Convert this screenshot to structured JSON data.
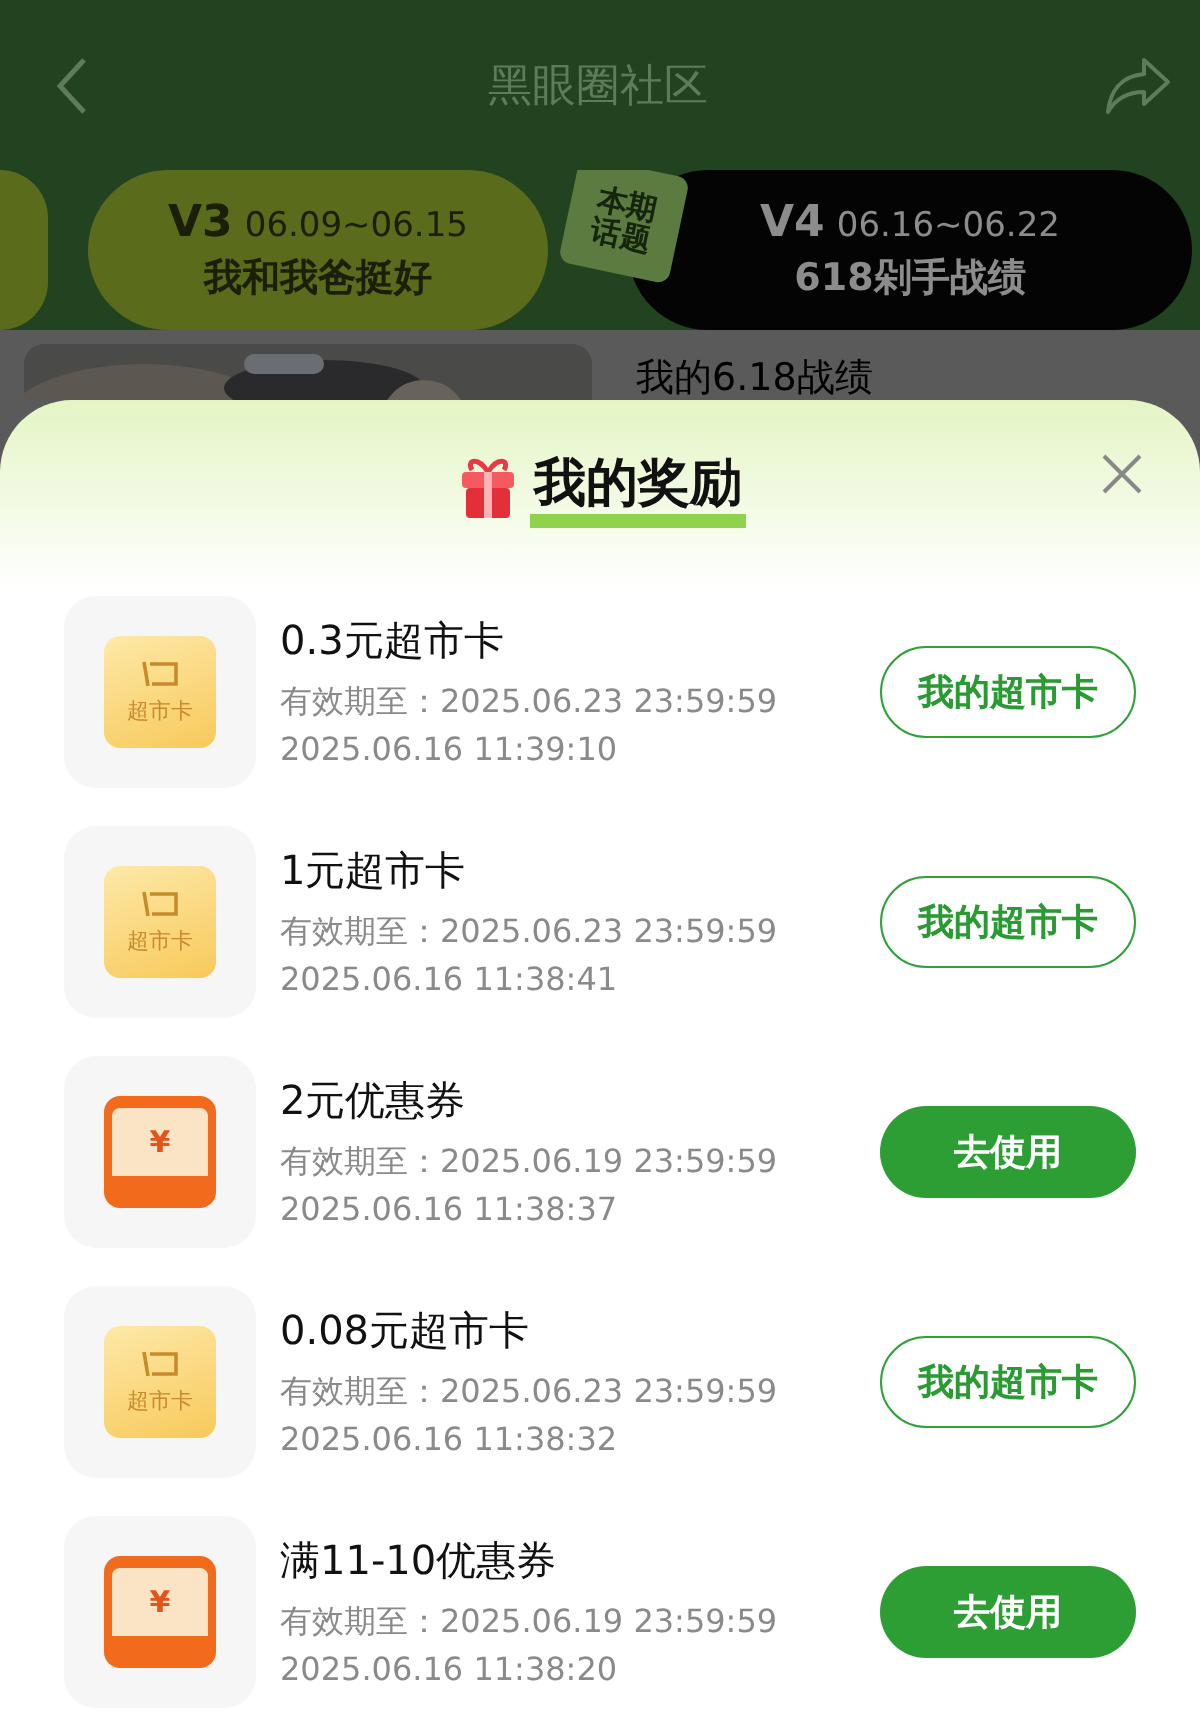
{
  "nav": {
    "title": "黑眼圈社区"
  },
  "tabs": [
    {
      "selected": false
    },
    {
      "version": "V3",
      "dates": "06.09~06.15",
      "topic": "我和我爸挺好",
      "selected": false
    },
    {
      "version": "V4",
      "dates": "06.16~06.22",
      "topic": "618剁手战绩",
      "selected": true,
      "badge": "本期话题"
    }
  ],
  "feed": {
    "post_title": "我的6.18战绩"
  },
  "sheet": {
    "title": "我的奖励",
    "rewards": [
      {
        "kind": "card",
        "icon_label": "超市卡",
        "name": "0.3元超市卡",
        "expiry": "有效期至：2025.06.23 23:59:59",
        "time": "2025.06.16 11:39:10",
        "action": "我的超市卡"
      },
      {
        "kind": "card",
        "icon_label": "超市卡",
        "name": "1元超市卡",
        "expiry": "有效期至：2025.06.23 23:59:59",
        "time": "2025.06.16 11:38:41",
        "action": "我的超市卡"
      },
      {
        "kind": "coupon",
        "icon_label": "¥",
        "name": "2元优惠券",
        "expiry": "有效期至：2025.06.19 23:59:59",
        "time": "2025.06.16 11:38:37",
        "action": "去使用"
      },
      {
        "kind": "card",
        "icon_label": "超市卡",
        "name": "0.08元超市卡",
        "expiry": "有效期至：2025.06.23 23:59:59",
        "time": "2025.06.16 11:38:32",
        "action": "我的超市卡"
      },
      {
        "kind": "coupon",
        "icon_label": "¥",
        "name": "满11-10优惠券",
        "expiry": "有效期至：2025.06.19 23:59:59",
        "time": "2025.06.16 11:38:20",
        "action": "去使用"
      }
    ]
  }
}
